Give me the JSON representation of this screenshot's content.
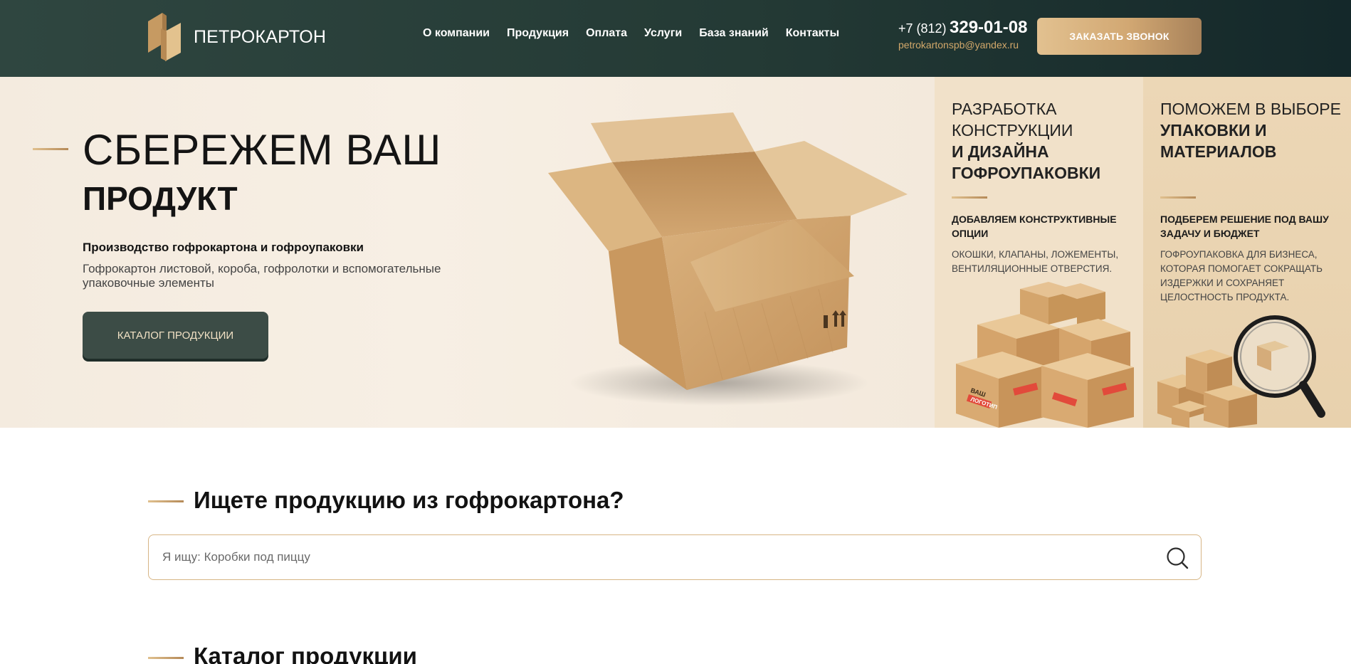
{
  "header": {
    "logo_text": "ПЕТРОКАРТОН",
    "nav": [
      "О компании",
      "Продукция",
      "Оплата",
      "Услуги",
      "База знаний",
      "Контакты"
    ],
    "phone_code": "+7 (812)",
    "phone_number": "329-01-08",
    "email": "petrokartonspb@yandex.ru",
    "call_button": "ЗАКАЗАТЬ ЗВОНОК"
  },
  "hero": {
    "title_line1": "СБЕРЕЖЕМ ВАШ",
    "title_line2": "ПРОДУКТ",
    "subtitle": "Производство гофрокартона и гофроупаковки",
    "description": "Гофрокартон листовой, короба, гофролотки и вспомогательные упаковочные элементы",
    "catalog_button": "КАТАЛОГ ПРОДУКЦИИ"
  },
  "panels": [
    {
      "title_light": "РАЗРАБОТКА КОНСТРУКЦИИ",
      "title_bold": "И ДИЗАЙНА ГОФРОУПАКОВКИ",
      "heading": "ДОБАВЛЯЕМ КОНСТРУКТИВНЫЕ ОПЦИИ",
      "text": "ОКОШКИ, КЛАПАНЫ, ЛОЖЕМЕНТЫ, ВЕНТИЛЯЦИОННЫЕ ОТВЕРСТИЯ."
    },
    {
      "title_light": "ПОМОЖЕМ В ВЫБОРЕ",
      "title_bold": "УПАКОВКИ И МАТЕРИАЛОВ",
      "heading": "ПОДБЕРЕМ РЕШЕНИЕ ПОД ВАШУ ЗАДАЧУ И БЮДЖЕТ",
      "text": "ГОФРОУПАКОВКА ДЛЯ БИЗНЕСА, КОТОРАЯ ПОМОГАЕТ СОКРАЩАТЬ ИЗДЕРЖКИ И СОХРАНЯЕТ ЦЕЛОСТНОСТЬ ПРОДУКТА."
    }
  ],
  "box_labels": [
    "ВАШ",
    "ЛОГОТИП"
  ],
  "search": {
    "title": "Ищете продукцию из гофрокартона?",
    "placeholder": "Я ищу: Коробки под пиццу"
  },
  "catalog": {
    "title": "Каталог продукции"
  },
  "colors": {
    "header_bg": "#243a35",
    "accent_gold": "#d2a873",
    "button_dark": "#3c4c46"
  }
}
